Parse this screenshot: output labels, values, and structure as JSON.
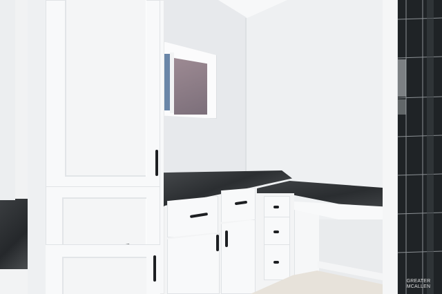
{
  "scene": {
    "description_free": true,
    "watermark": {
      "line1": "",
      "line2": "GREATER MCALLEN"
    },
    "colors": {
      "wall": "#e9ebee",
      "wall_right": "#eef0f2",
      "ceiling": "#f4f5f6",
      "cabinet": "#f6f7f8",
      "cabinet_shadow": "#dfe2e5",
      "granite": "#34373a",
      "tile": "#1f2326",
      "floor": "#e6e1d8",
      "window_glass": "#8f7d86",
      "handle": "#1d1f22"
    }
  }
}
